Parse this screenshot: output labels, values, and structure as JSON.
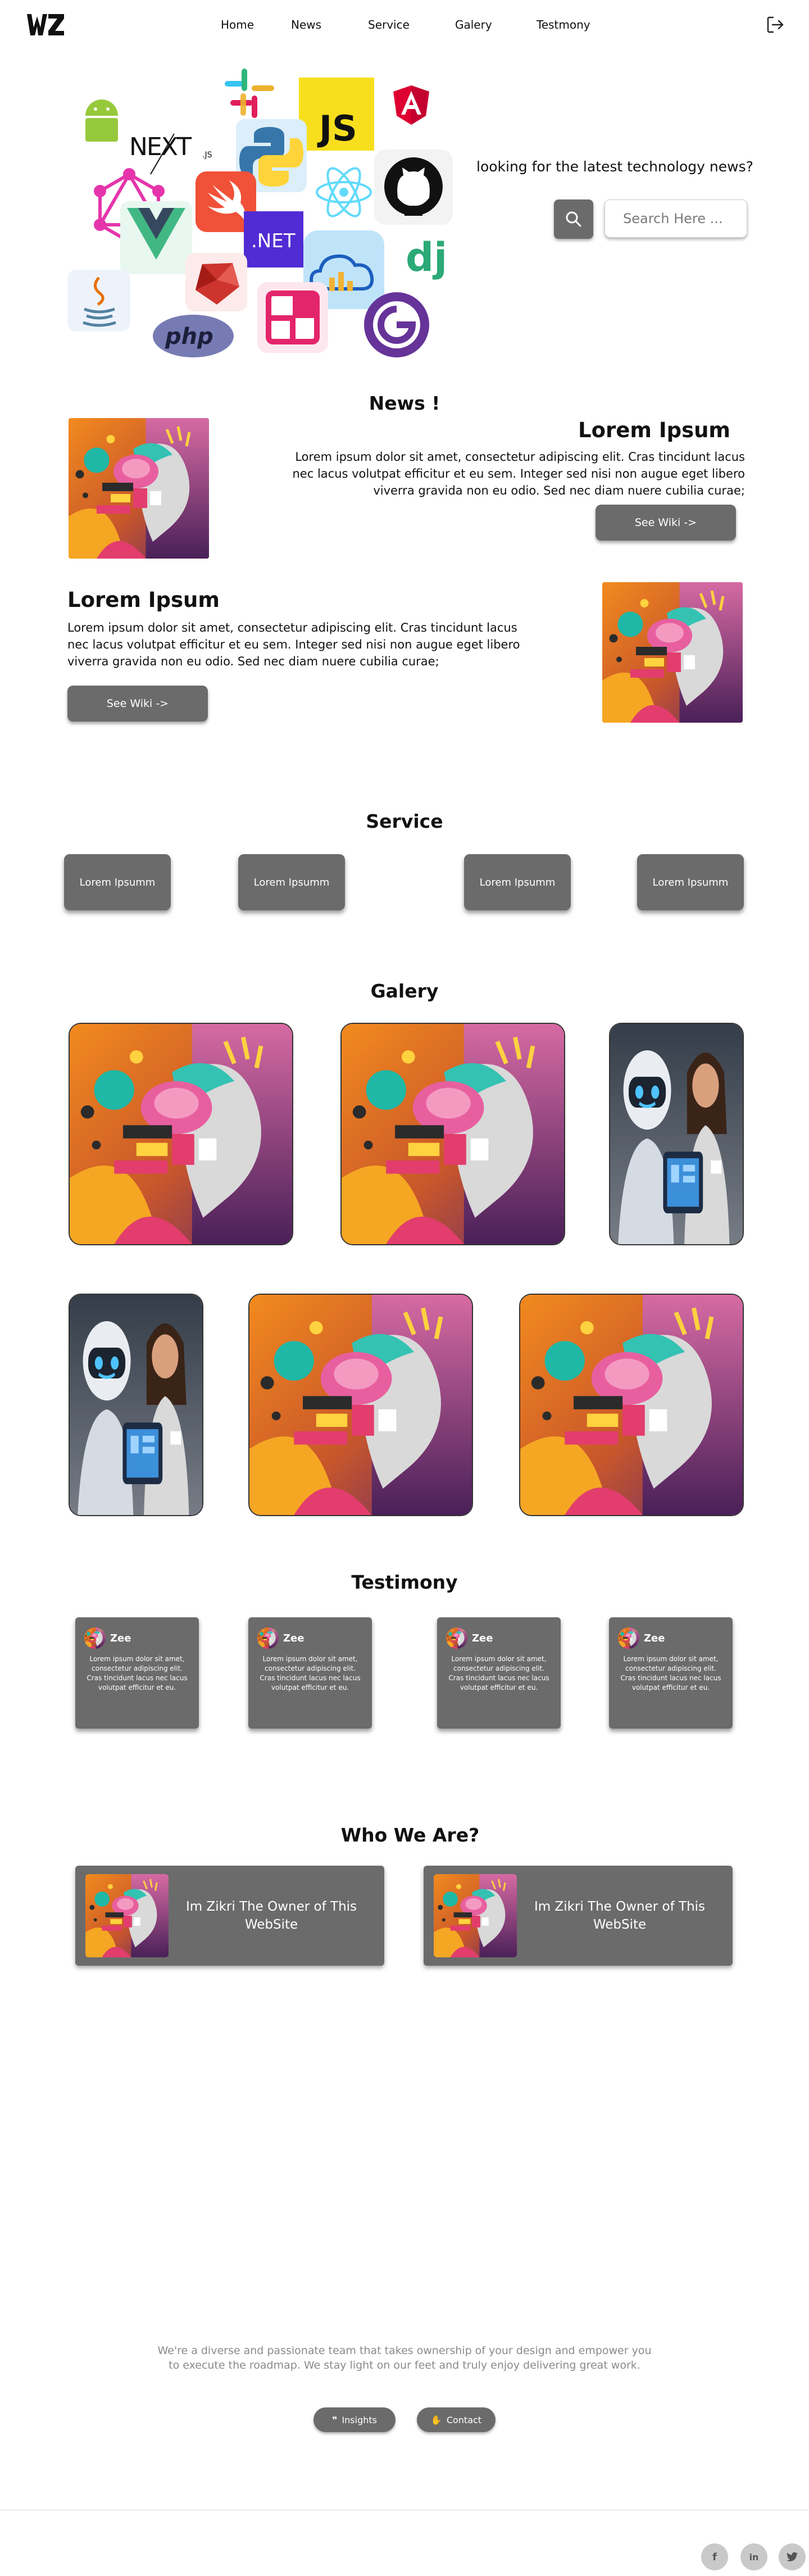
{
  "nav": {
    "logo": "WZ logo",
    "links": [
      "Home",
      "News",
      "Service",
      "Galery",
      "Testmony"
    ]
  },
  "hero": {
    "question": "looking for the latest technology news?",
    "search_placeholder": "Search Here ..."
  },
  "news": {
    "title": "News !",
    "items": [
      {
        "heading": "Lorem Ipsum",
        "body": "Lorem ipsum dolor sit amet, consectetur adipiscing elit. Cras tincidunt lacus nec lacus volutpat efficitur et eu sem. Integer sed nisi non augue eget libero viverra gravida non eu odio. Sed nec diam nuere cubilia curae;",
        "button": "See Wiki ->"
      },
      {
        "heading": "Lorem Ipsum",
        "body": "Lorem ipsum dolor sit amet, consectetur adipiscing elit. Cras tincidunt lacus nec lacus volutpat efficitur et eu sem. Integer sed nisi non augue eget libero viverra gravida non eu odio. Sed nec diam nuere cubilia curae;",
        "button": "See Wiki ->"
      }
    ]
  },
  "service": {
    "title": "Service",
    "cards": [
      "Lorem Ipsumm",
      "Lorem Ipsumm",
      "Lorem Ipsumm",
      "Lorem Ipsumm"
    ]
  },
  "galery": {
    "title": "Galery"
  },
  "testimony": {
    "title": "Testimony",
    "cards": [
      {
        "name": "Zee",
        "text": "Lorem ipsum dolor sit amet, consectetur adipiscing elit. Cras tincidunt lacus nec lacus volutpat efficitur et eu."
      },
      {
        "name": "Zee",
        "text": "Lorem ipsum dolor sit amet, consectetur adipiscing elit. Cras tincidunt lacus nec lacus volutpat efficitur et eu."
      },
      {
        "name": "Zee",
        "text": "Lorem ipsum dolor sit amet, consectetur adipiscing elit. Cras tincidunt lacus nec lacus volutpat efficitur et eu."
      },
      {
        "name": "Zee",
        "text": "Lorem ipsum dolor sit amet, consectetur adipiscing elit. Cras tincidunt lacus nec lacus volutpat efficitur et eu."
      }
    ]
  },
  "who": {
    "title": "Who We Are?",
    "cards": [
      "Im Zikri The Owner of This WebSite",
      "Im Zikri The Owner of This WebSite"
    ]
  },
  "footer": {
    "text": "We're a diverse and passionate team that takes ownership of your design and empower you to execute the roadmap. We stay light on our feet and truly enjoy delivering great work.",
    "insights": "Insights",
    "contact": "Contact",
    "social": [
      "f",
      "in",
      "t"
    ]
  },
  "colors": {
    "card": "#6b6b6b",
    "footer_text": "#8a8a8a"
  },
  "hero_tech_logos": [
    "Android",
    "Slack",
    "JS",
    "Angular",
    "NEXT.js",
    "Python",
    "GitHub",
    "GraphQL",
    "Vue",
    "Swift",
    ".NET",
    "React",
    "Cloud",
    "dj",
    "Java",
    "Ruby",
    "Gatsby",
    "php"
  ]
}
